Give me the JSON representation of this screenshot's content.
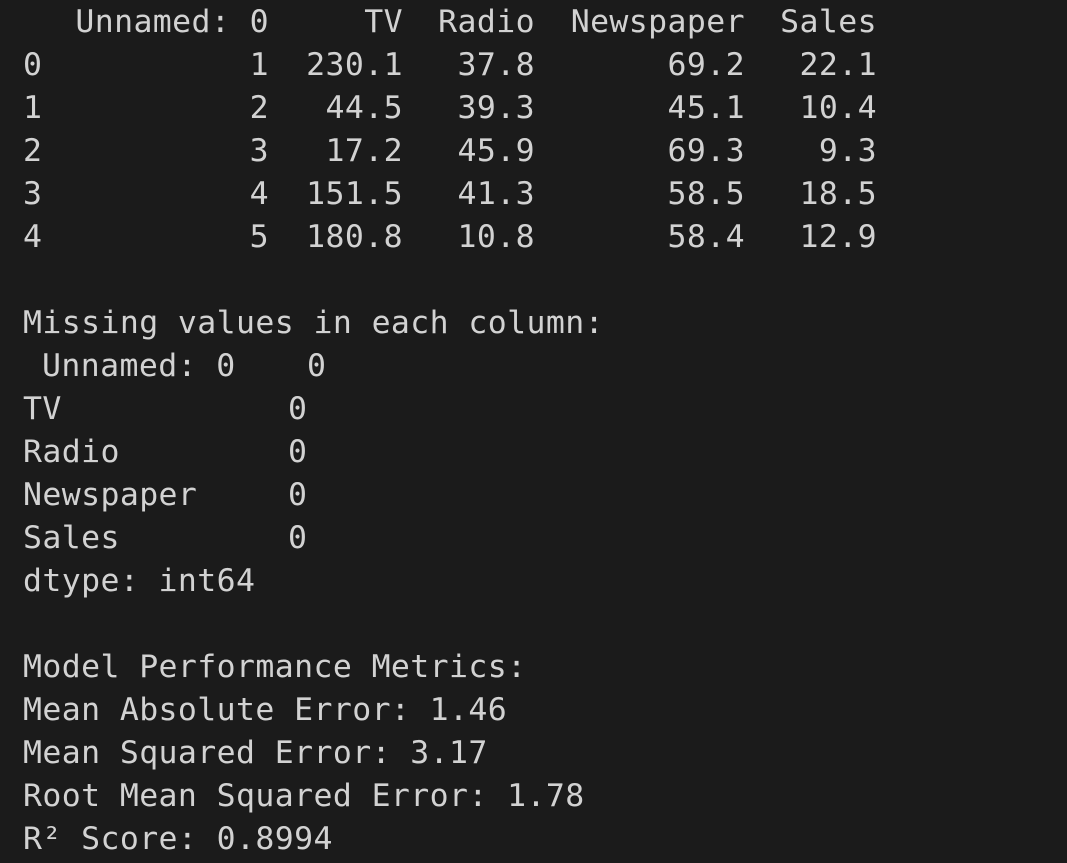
{
  "dataframe": {
    "columns": [
      "Unnamed: 0",
      "TV",
      "Radio",
      "Newspaper",
      "Sales"
    ],
    "rows": [
      {
        "index": "0",
        "unnamed": "1",
        "tv": "230.1",
        "radio": "37.8",
        "newspaper": "69.2",
        "sales": "22.1"
      },
      {
        "index": "1",
        "unnamed": "2",
        "tv": "44.5",
        "radio": "39.3",
        "newspaper": "45.1",
        "sales": "10.4"
      },
      {
        "index": "2",
        "unnamed": "3",
        "tv": "17.2",
        "radio": "45.9",
        "newspaper": "69.3",
        "sales": "9.3"
      },
      {
        "index": "3",
        "unnamed": "4",
        "tv": "151.5",
        "radio": "41.3",
        "newspaper": "58.5",
        "sales": "18.5"
      },
      {
        "index": "4",
        "unnamed": "5",
        "tv": "180.8",
        "radio": "10.8",
        "newspaper": "58.4",
        "sales": "12.9"
      }
    ]
  },
  "missing": {
    "heading": "Missing values in each column:",
    "items": [
      {
        "name": "Unnamed: 0",
        "value": "0"
      },
      {
        "name": "TV",
        "value": "0"
      },
      {
        "name": "Radio",
        "value": "0"
      },
      {
        "name": "Newspaper",
        "value": "0"
      },
      {
        "name": "Sales",
        "value": "0"
      }
    ],
    "dtype": "dtype: int64"
  },
  "metrics": {
    "heading": "Model Performance Metrics:",
    "mae": "Mean Absolute Error: 1.46",
    "mse": "Mean Squared Error: 3.17",
    "rmse": "Root Mean Squared Error: 1.78",
    "r2": "R² Score: 0.8994"
  },
  "colors": {
    "background": "#1b1b1b",
    "text": "#d2d2d2"
  }
}
